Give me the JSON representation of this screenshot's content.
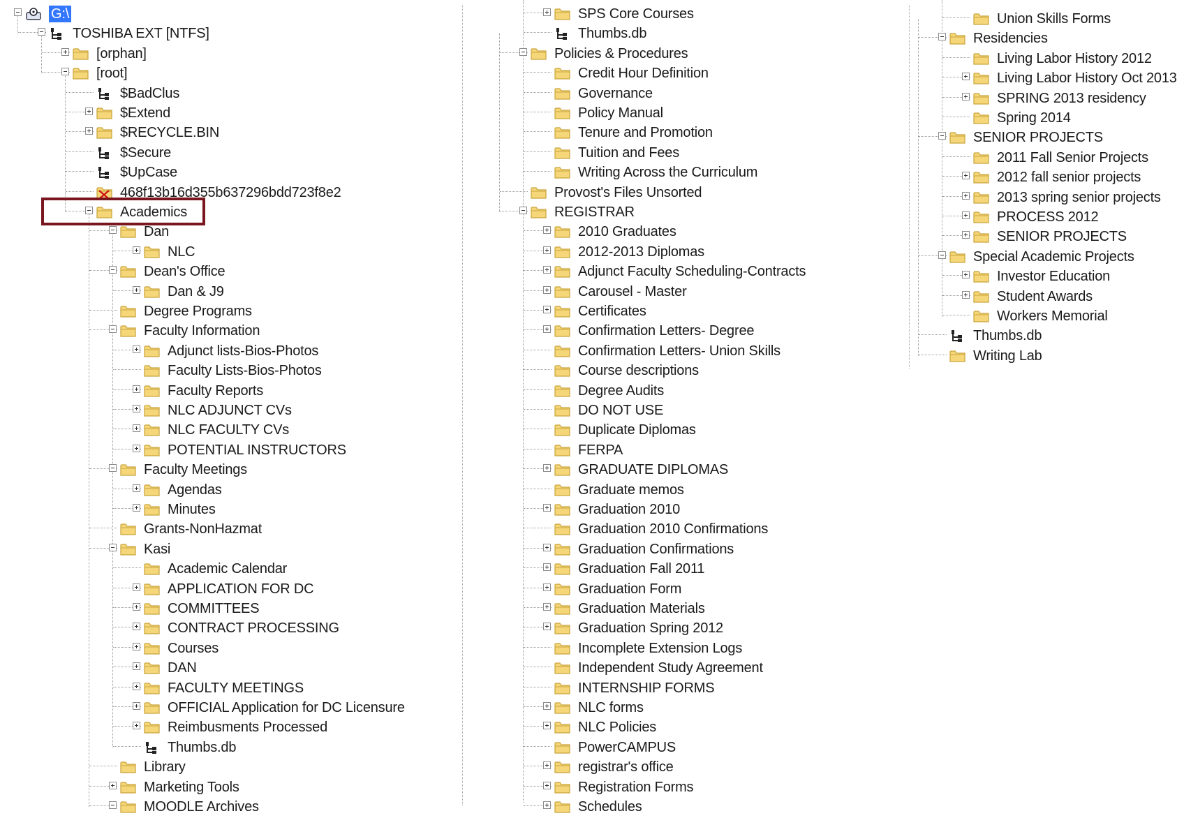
{
  "colors": {
    "highlight_border": "#7a1620",
    "folder_fill": "#f5d77a",
    "folder_stroke": "#c9a33a",
    "drive_selected": "#3377ff"
  },
  "col1": [
    {
      "label": "G:\\",
      "icon": "drive-icon",
      "expander": "minus"
    },
    {
      "label": "TOSHIBA EXT [NTFS]",
      "icon": "volume-icon",
      "expander": "minus"
    },
    {
      "label": "[orphan]",
      "icon": "folder-icon",
      "expander": "plus"
    },
    {
      "label": "[root]",
      "icon": "folder-icon",
      "expander": "minus"
    },
    {
      "label": "$BadClus",
      "icon": "file-icon",
      "expander": "none"
    },
    {
      "label": "$Extend",
      "icon": "folder-icon",
      "expander": "plus"
    },
    {
      "label": "$RECYCLE.BIN",
      "icon": "folder-icon",
      "expander": "plus"
    },
    {
      "label": "$Secure",
      "icon": "file-icon",
      "expander": "none"
    },
    {
      "label": "$UpCase",
      "icon": "file-icon",
      "expander": "none"
    },
    {
      "label": "468f13b16d355b637296bdd723f8e2",
      "icon": "deleted-folder-icon",
      "expander": "none"
    },
    {
      "label": "Academics",
      "icon": "folder-icon",
      "expander": "minus"
    },
    {
      "label": "Dan",
      "icon": "folder-icon",
      "expander": "minus"
    },
    {
      "label": "NLC",
      "icon": "folder-icon",
      "expander": "plus"
    },
    {
      "label": "Dean's Office",
      "icon": "folder-icon",
      "expander": "minus"
    },
    {
      "label": "Dan & J9",
      "icon": "folder-icon",
      "expander": "plus"
    },
    {
      "label": "Degree Programs",
      "icon": "folder-icon",
      "expander": "none"
    },
    {
      "label": "Faculty Information",
      "icon": "folder-icon",
      "expander": "minus"
    },
    {
      "label": "Adjunct lists-Bios-Photos",
      "icon": "folder-icon",
      "expander": "plus"
    },
    {
      "label": "Faculty Lists-Bios-Photos",
      "icon": "folder-icon",
      "expander": "none"
    },
    {
      "label": "Faculty Reports",
      "icon": "folder-icon",
      "expander": "plus"
    },
    {
      "label": "NLC ADJUNCT CVs",
      "icon": "folder-icon",
      "expander": "plus"
    },
    {
      "label": "NLC FACULTY CVs",
      "icon": "folder-icon",
      "expander": "plus"
    },
    {
      "label": "POTENTIAL INSTRUCTORS",
      "icon": "folder-icon",
      "expander": "plus"
    },
    {
      "label": "Faculty Meetings",
      "icon": "folder-icon",
      "expander": "minus"
    },
    {
      "label": "Agendas",
      "icon": "folder-icon",
      "expander": "plus"
    },
    {
      "label": "Minutes",
      "icon": "folder-icon",
      "expander": "plus"
    },
    {
      "label": "Grants-NonHazmat",
      "icon": "folder-icon",
      "expander": "none"
    },
    {
      "label": "Kasi",
      "icon": "folder-icon",
      "expander": "minus"
    },
    {
      "label": "Academic Calendar",
      "icon": "folder-icon",
      "expander": "none"
    },
    {
      "label": "APPLICATION FOR DC",
      "icon": "folder-icon",
      "expander": "plus"
    },
    {
      "label": "COMMITTEES",
      "icon": "folder-icon",
      "expander": "plus"
    },
    {
      "label": "CONTRACT PROCESSING",
      "icon": "folder-icon",
      "expander": "plus"
    },
    {
      "label": "Courses",
      "icon": "folder-icon",
      "expander": "plus"
    },
    {
      "label": "DAN",
      "icon": "folder-icon",
      "expander": "plus"
    },
    {
      "label": "FACULTY MEETINGS",
      "icon": "folder-icon",
      "expander": "plus"
    },
    {
      "label": "OFFICIAL Application for DC Licensure",
      "icon": "folder-icon",
      "expander": "plus"
    },
    {
      "label": "Reimbusments Processed",
      "icon": "folder-icon",
      "expander": "plus"
    },
    {
      "label": "Thumbs.db",
      "icon": "file-icon",
      "expander": "none"
    },
    {
      "label": "Library",
      "icon": "folder-icon",
      "expander": "none"
    },
    {
      "label": "Marketing Tools",
      "icon": "folder-icon",
      "expander": "plus"
    },
    {
      "label": "MOODLE Archives",
      "icon": "folder-icon",
      "expander": "minus"
    }
  ],
  "col2": [
    {
      "label": "SPS Core Courses",
      "icon": "folder-icon",
      "expander": "plus"
    },
    {
      "label": "Thumbs.db",
      "icon": "file-icon",
      "expander": "none"
    },
    {
      "label": "Policies & Procedures",
      "icon": "folder-icon",
      "expander": "minus"
    },
    {
      "label": "Credit Hour Definition",
      "icon": "folder-icon",
      "expander": "none"
    },
    {
      "label": "Governance",
      "icon": "folder-icon",
      "expander": "none"
    },
    {
      "label": "Policy Manual",
      "icon": "folder-icon",
      "expander": "none"
    },
    {
      "label": "Tenure and Promotion",
      "icon": "folder-icon",
      "expander": "none"
    },
    {
      "label": "Tuition and Fees",
      "icon": "folder-icon",
      "expander": "none"
    },
    {
      "label": "Writing Across the Curriculum",
      "icon": "folder-icon",
      "expander": "none"
    },
    {
      "label": "Provost's Files Unsorted",
      "icon": "folder-icon",
      "expander": "none"
    },
    {
      "label": "REGISTRAR",
      "icon": "folder-icon",
      "expander": "minus"
    },
    {
      "label": "2010 Graduates",
      "icon": "folder-icon",
      "expander": "plus"
    },
    {
      "label": "2012-2013 Diplomas",
      "icon": "folder-icon",
      "expander": "plus"
    },
    {
      "label": "Adjunct Faculty Scheduling-Contracts",
      "icon": "folder-icon",
      "expander": "plus"
    },
    {
      "label": "Carousel - Master",
      "icon": "folder-icon",
      "expander": "plus"
    },
    {
      "label": "Certificates",
      "icon": "folder-icon",
      "expander": "plus"
    },
    {
      "label": "Confirmation Letters- Degree",
      "icon": "folder-icon",
      "expander": "plus"
    },
    {
      "label": "Confirmation Letters- Union Skills",
      "icon": "folder-icon",
      "expander": "none"
    },
    {
      "label": "Course descriptions",
      "icon": "folder-icon",
      "expander": "none"
    },
    {
      "label": "Degree Audits",
      "icon": "folder-icon",
      "expander": "none"
    },
    {
      "label": "DO NOT USE",
      "icon": "folder-icon",
      "expander": "none"
    },
    {
      "label": "Duplicate Diplomas",
      "icon": "folder-icon",
      "expander": "none"
    },
    {
      "label": "FERPA",
      "icon": "folder-icon",
      "expander": "none"
    },
    {
      "label": "GRADUATE DIPLOMAS",
      "icon": "folder-icon",
      "expander": "plus"
    },
    {
      "label": "Graduate memos",
      "icon": "folder-icon",
      "expander": "none"
    },
    {
      "label": "Graduation 2010",
      "icon": "folder-icon",
      "expander": "plus"
    },
    {
      "label": "Graduation 2010 Confirmations",
      "icon": "folder-icon",
      "expander": "none"
    },
    {
      "label": "Graduation Confirmations",
      "icon": "folder-icon",
      "expander": "plus"
    },
    {
      "label": "Graduation Fall 2011",
      "icon": "folder-icon",
      "expander": "plus"
    },
    {
      "label": "Graduation Form",
      "icon": "folder-icon",
      "expander": "plus"
    },
    {
      "label": "Graduation Materials",
      "icon": "folder-icon",
      "expander": "plus"
    },
    {
      "label": "Graduation Spring 2012",
      "icon": "folder-icon",
      "expander": "plus"
    },
    {
      "label": "Incomplete Extension Logs",
      "icon": "folder-icon",
      "expander": "none"
    },
    {
      "label": "Independent Study Agreement",
      "icon": "folder-icon",
      "expander": "none"
    },
    {
      "label": "INTERNSHIP FORMS",
      "icon": "folder-icon",
      "expander": "none"
    },
    {
      "label": "NLC forms",
      "icon": "folder-icon",
      "expander": "plus"
    },
    {
      "label": "NLC Policies",
      "icon": "folder-icon",
      "expander": "plus"
    },
    {
      "label": "PowerCAMPUS",
      "icon": "folder-icon",
      "expander": "none"
    },
    {
      "label": "registrar's office",
      "icon": "folder-icon",
      "expander": "plus"
    },
    {
      "label": "Registration Forms",
      "icon": "folder-icon",
      "expander": "plus"
    },
    {
      "label": "Schedules",
      "icon": "folder-icon",
      "expander": "plus"
    }
  ],
  "col3": [
    {
      "label": "Union Skills Forms",
      "icon": "folder-icon",
      "expander": "none"
    },
    {
      "label": "Residencies",
      "icon": "folder-icon",
      "expander": "minus"
    },
    {
      "label": "Living Labor History 2012",
      "icon": "folder-icon",
      "expander": "none"
    },
    {
      "label": "Living Labor History Oct 2013",
      "icon": "folder-icon",
      "expander": "plus"
    },
    {
      "label": "SPRING 2013 residency",
      "icon": "folder-icon",
      "expander": "plus"
    },
    {
      "label": "Spring 2014",
      "icon": "folder-icon",
      "expander": "none"
    },
    {
      "label": "SENIOR PROJECTS",
      "icon": "folder-icon",
      "expander": "minus"
    },
    {
      "label": "2011 Fall Senior Projects",
      "icon": "folder-icon",
      "expander": "none"
    },
    {
      "label": "2012 fall senior projects",
      "icon": "folder-icon",
      "expander": "plus"
    },
    {
      "label": "2013 spring senior projects",
      "icon": "folder-icon",
      "expander": "plus"
    },
    {
      "label": "PROCESS 2012",
      "icon": "folder-icon",
      "expander": "plus"
    },
    {
      "label": "SENIOR PROJECTS",
      "icon": "folder-icon",
      "expander": "plus"
    },
    {
      "label": "Special Academic Projects",
      "icon": "folder-icon",
      "expander": "minus"
    },
    {
      "label": "Investor Education",
      "icon": "folder-icon",
      "expander": "plus"
    },
    {
      "label": "Student Awards",
      "icon": "folder-icon",
      "expander": "plus"
    },
    {
      "label": "Workers Memorial",
      "icon": "folder-icon",
      "expander": "none"
    },
    {
      "label": "Thumbs.db",
      "icon": "file-icon",
      "expander": "none"
    },
    {
      "label": "Writing Lab",
      "icon": "folder-icon",
      "expander": "none"
    }
  ]
}
